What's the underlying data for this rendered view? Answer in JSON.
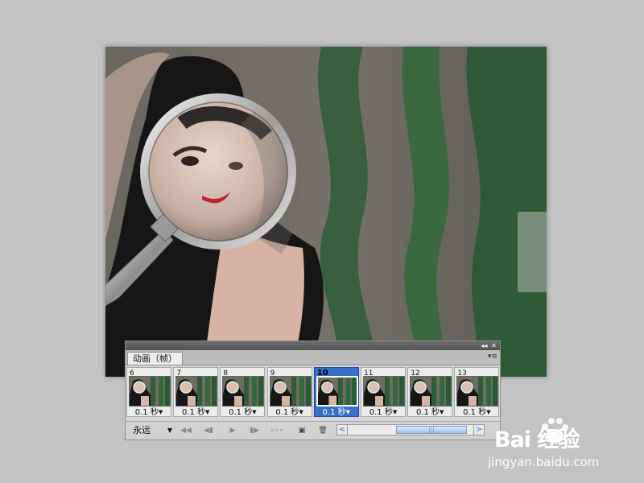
{
  "panel": {
    "tab_label": "动画（帧）",
    "collapse_glyph": "◂◂",
    "close_glyph": "✕",
    "menu_glyph": "▾≡",
    "frames": [
      {
        "number": "6",
        "delay": "0.1 秒",
        "selected": false
      },
      {
        "number": "7",
        "delay": "0.1 秒",
        "selected": false
      },
      {
        "number": "8",
        "delay": "0.1 秒",
        "selected": false
      },
      {
        "number": "9",
        "delay": "0.1 秒",
        "selected": false
      },
      {
        "number": "10",
        "delay": "0.1 秒",
        "selected": true
      },
      {
        "number": "11",
        "delay": "0.1 秒",
        "selected": false
      },
      {
        "number": "12",
        "delay": "0.1 秒",
        "selected": false
      },
      {
        "number": "13",
        "delay": "0.1 秒",
        "selected": false
      }
    ],
    "loop_option": "永远",
    "scroll_left_glyph": "<",
    "scroll_right_glyph": ">",
    "scroll_thumb_glyph": "|||"
  },
  "toolbar": {
    "icons": [
      "first-frame-icon",
      "previous-frame-icon",
      "play-icon",
      "next-frame-icon",
      "tween-icon",
      "new-frame-icon",
      "delete-frame-icon"
    ]
  },
  "watermark": {
    "logo_text": "Bai  经验",
    "url": "jingyan.baidu.com"
  },
  "colors": {
    "background": "#c3c3c3",
    "selected_frame": "#3a6fc9",
    "panel": "#d6d6d6"
  }
}
